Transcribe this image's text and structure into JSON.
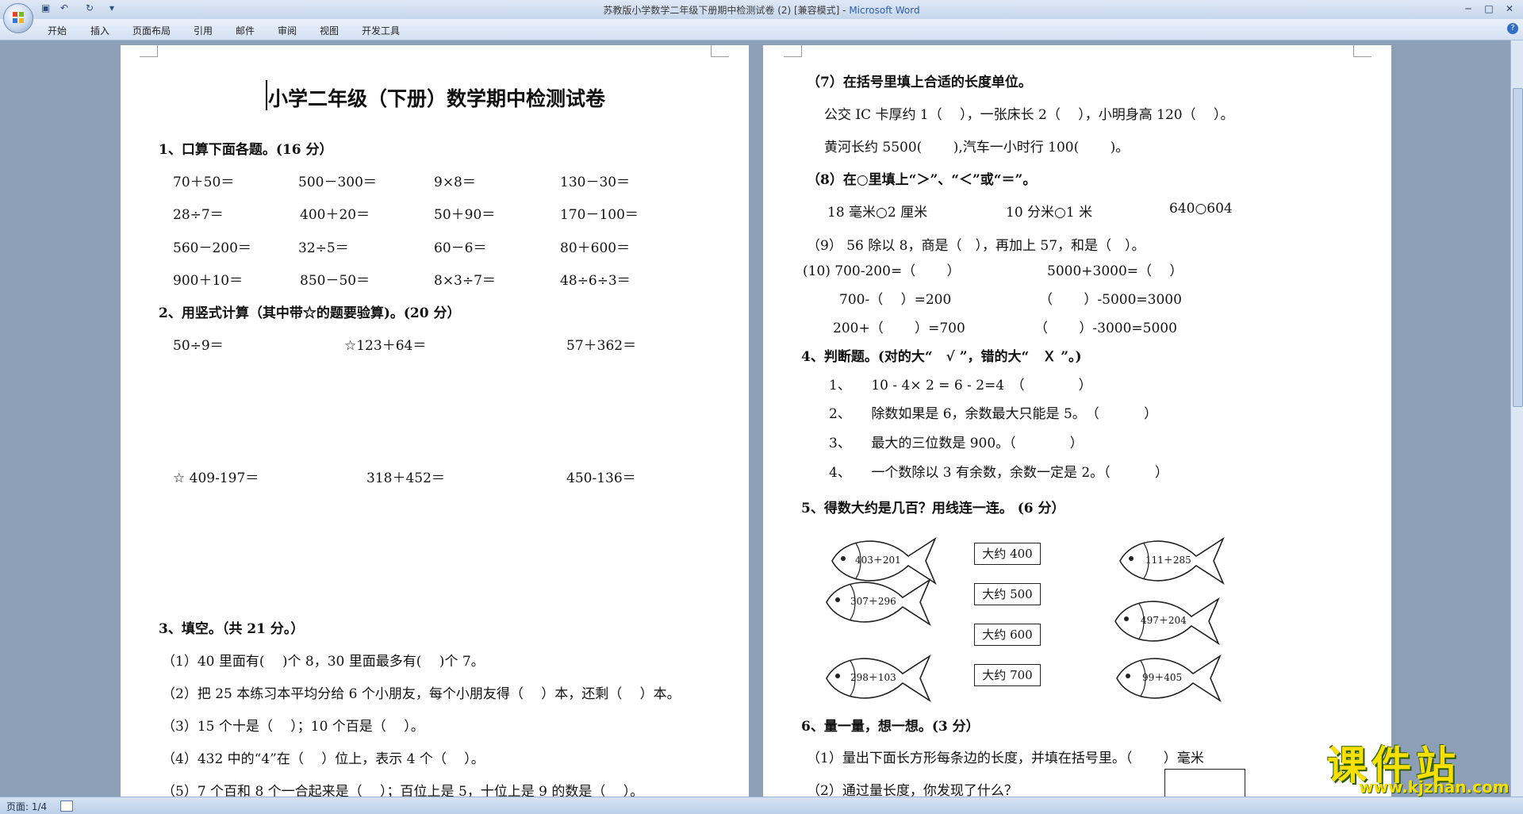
{
  "window": {
    "title_doc": "苏教版小学数学二年级下册期中检测试卷 (2) [兼容模式] - ",
    "title_app": "Microsoft Word",
    "minimize_glyph": "─",
    "maximize_glyph": "□",
    "close_glyph": "✕",
    "quick_save": "▣",
    "quick_undo": "↶",
    "quick_redo": "↻",
    "quick_more": "▾"
  },
  "ribbon": {
    "tabs": [
      "开始",
      "插入",
      "页面布局",
      "引用",
      "邮件",
      "审阅",
      "视图",
      "开发工具"
    ],
    "help": "?"
  },
  "status": {
    "page": "页面: 1/4"
  },
  "watermark": {
    "main": "课件站",
    "sub": "www.kjzhan.com"
  },
  "page1": {
    "title": "小学二年级（下册）数学期中检测试卷",
    "q1": "1、口算下面各题。(16 分）",
    "q1_items": [
      [
        "70＋50＝",
        "500－300＝",
        "9×8＝",
        "130－30＝"
      ],
      [
        "28÷7＝",
        "400＋20＝",
        "50＋90＝",
        "170－100＝"
      ],
      [
        "560－200＝",
        "32÷5＝",
        "60－6＝",
        "80＋600＝"
      ],
      [
        "900＋10＝",
        "850－50＝",
        "8×3÷7＝",
        "48÷6÷3＝"
      ]
    ],
    "q2": "2、用竖式计算（其中带☆的题要验算)。(20 分）",
    "q2_row1": [
      "50÷9＝",
      "☆123＋64＝",
      "57＋362＝"
    ],
    "q2_row2": [
      "☆ 409-197＝",
      "318＋452＝",
      "450-136＝"
    ],
    "q3": "3、填空。（共 21 分。）",
    "q3_items": [
      "（1）40 里面有(　 )个 8，30 里面最多有(　 )个 7。",
      "（2）把 25 本练习本平均分给 6 个小朋友，每个小朋友得（　 ）本，还剩（　 ）本。",
      "（3）15 个十是（　 ）；10 个百是（　 ）。",
      "（4）432 中的“4”在（　 ）位上，表示 4 个（　 ）。",
      "（5）7 个百和 8 个一合起来是（　 ）；百位上是 5，十位上是 9 的数是（　 ）。"
    ]
  },
  "page2": {
    "q7": "（7）在括号里填上合适的长度单位。",
    "q7_l1": "公交 IC 卡厚约 1（　 ），一张床长 2（　 ），小明身高 120（　 ）。",
    "q7_l2": "黄河长约 5500(　 　),汽车一小时行 100(　 　)。",
    "q8": "（8）在○里填上“＞”、“＜”或“＝”。",
    "q8_items": [
      "18 毫米○2 厘米",
      "10 分米○1 米",
      "640○604"
    ],
    "q9": "（9） 56 除以 8，商是（　），再加上 57，和是（　）。",
    "q10": "(10) 700-200=（　 　）",
    "q10b": "5000+3000=（　 ）",
    "q10_l2a": "700-（　 ）=200",
    "q10_l2b": "（　 　）-5000=3000",
    "q10_l3a": "200+（　 　）=700",
    "q10_l3b": "（　 　）-3000=5000",
    "q4": "4、判断题。(对的大“　√ ”，错的大“　Ｘ ”。)",
    "q4_items": [
      "1、　　10 - 4× 2 = 6 - 2=4　（　　　　）",
      "2、　　除数如果是 6，余数最大只能是 5。　（　　　 ）",
      "3、　　最大的三位数是 900。（　　　　）",
      "4、　　一个数除以 3 有余数，余数一定是 2。（　　　 ）"
    ],
    "q5": "5、得数大约是几百？用线连一连。 (6 分）",
    "fish_left": [
      "403＋201",
      "307＋296",
      "298＋103"
    ],
    "fish_right": [
      "111＋285",
      "497＋204",
      "99＋405"
    ],
    "boxes": [
      "大约 400",
      "大约 500",
      "大约 600",
      "大约 700"
    ],
    "q6": "6、量一量，想一想。(3 分）",
    "q6_items": [
      "（1）量出下面长方形每条边的长度，并填在括号里。（　　 ）毫米",
      "（2）通过量长度，你发现了什么？"
    ]
  }
}
